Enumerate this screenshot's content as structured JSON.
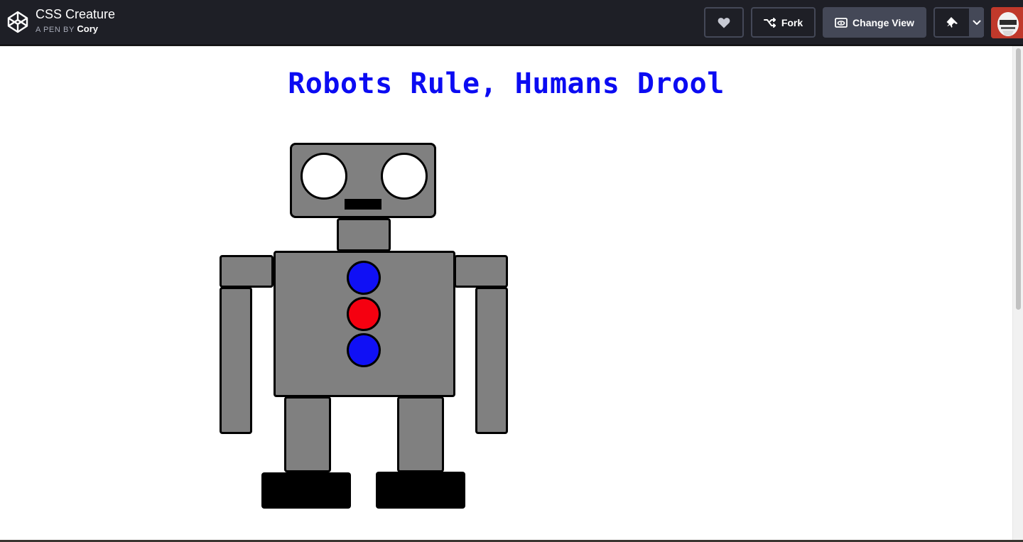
{
  "header": {
    "pen_title": "CSS Creature",
    "pen_by_label": "A PEN BY",
    "author": "Cory",
    "buttons": {
      "heart_icon": "heart-icon",
      "fork_label": "Fork",
      "change_view_label": "Change View",
      "pin_icon": "pin-icon",
      "dropdown_icon": "chevron-down-icon"
    }
  },
  "preview": {
    "heading": "Robots Rule, Humans Drool",
    "heading_color": "#0b0bf2"
  },
  "colors": {
    "header_bg": "#1e1f26",
    "button_border": "#444857",
    "robot_body": "#808080",
    "chest_button_blue": "#1010f5",
    "chest_button_red": "#f50010"
  }
}
